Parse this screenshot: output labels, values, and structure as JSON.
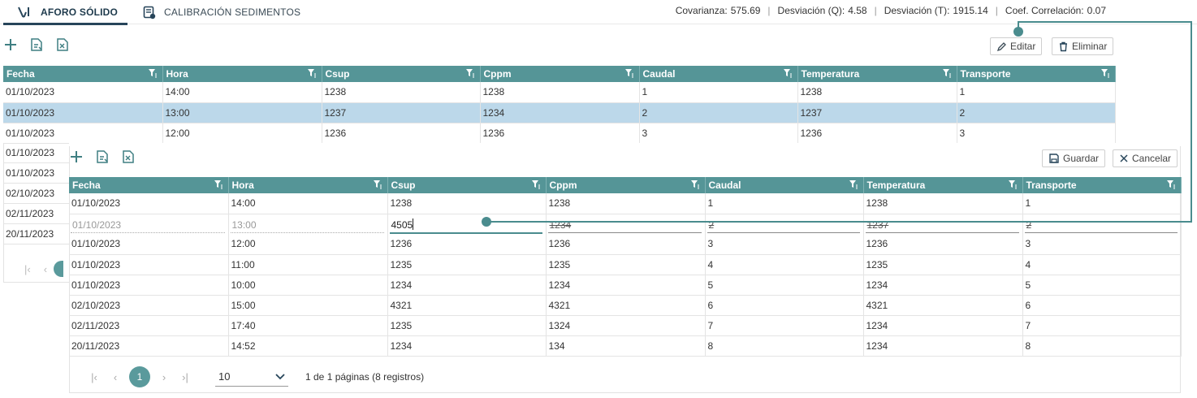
{
  "tabs": [
    {
      "label": "AFORO SÓLIDO",
      "icon": "aforo-icon",
      "active": true
    },
    {
      "label": "CALIBRACIÓN SEDIMENTOS",
      "icon": "document-settings-icon",
      "active": false
    }
  ],
  "stats": {
    "covarianza_label": "Covarianza:",
    "covarianza_value": "575.69",
    "desv_q_label": "Desviación (Q):",
    "desv_q_value": "4.58",
    "desv_t_label": "Desviación (T):",
    "desv_t_value": "1915.14",
    "coef_label": "Coef. Correlación:",
    "coef_value": "0.07"
  },
  "toolbar1": {
    "edit_label": "Editar",
    "delete_label": "Eliminar"
  },
  "toolbar2": {
    "save_label": "Guardar",
    "cancel_label": "Cancelar"
  },
  "columns": [
    "Fecha",
    "Hora",
    "Csup",
    "Cppm",
    "Caudal",
    "Temperatura",
    "Transporte"
  ],
  "grid1": {
    "rows": [
      [
        "01/10/2023",
        "14:00",
        "1238",
        "1238",
        "1",
        "1238",
        "1"
      ],
      [
        "01/10/2023",
        "13:00",
        "1237",
        "1234",
        "2",
        "1237",
        "2"
      ],
      [
        "01/10/2023",
        "12:00",
        "1236",
        "1236",
        "3",
        "1236",
        "3"
      ]
    ],
    "hidden_dates": [
      "01/10/2023",
      "01/10/2023",
      "02/10/2023",
      "02/11/2023",
      "20/11/2023"
    ]
  },
  "grid2": {
    "row_first": [
      "01/10/2023",
      "14:00",
      "1238",
      "1238",
      "1",
      "1238",
      "1"
    ],
    "edit_row": {
      "fecha": "01/10/2023",
      "hora": "13:00",
      "csup": "4505",
      "cppm": "1234",
      "caudal": "2",
      "temperatura": "1237",
      "transporte": "2"
    },
    "rows": [
      [
        "01/10/2023",
        "12:00",
        "1236",
        "1236",
        "3",
        "1236",
        "3"
      ],
      [
        "01/10/2023",
        "11:00",
        "1235",
        "1235",
        "4",
        "1235",
        "4"
      ],
      [
        "01/10/2023",
        "10:00",
        "1234",
        "1234",
        "5",
        "1234",
        "5"
      ],
      [
        "02/10/2023",
        "15:00",
        "4321",
        "4321",
        "6",
        "4321",
        "6"
      ],
      [
        "02/11/2023",
        "17:40",
        "1235",
        "1324",
        "7",
        "1234",
        "7"
      ],
      [
        "20/11/2023",
        "14:52",
        "1234",
        "134",
        "8",
        "1234",
        "8"
      ]
    ]
  },
  "pager": {
    "current": "1",
    "page_size": "10",
    "summary": "1 de 1 páginas (8 registros)"
  },
  "colors": {
    "header": "#559597",
    "accent": "#4a8c8e",
    "selected": "#bcd8ea"
  }
}
